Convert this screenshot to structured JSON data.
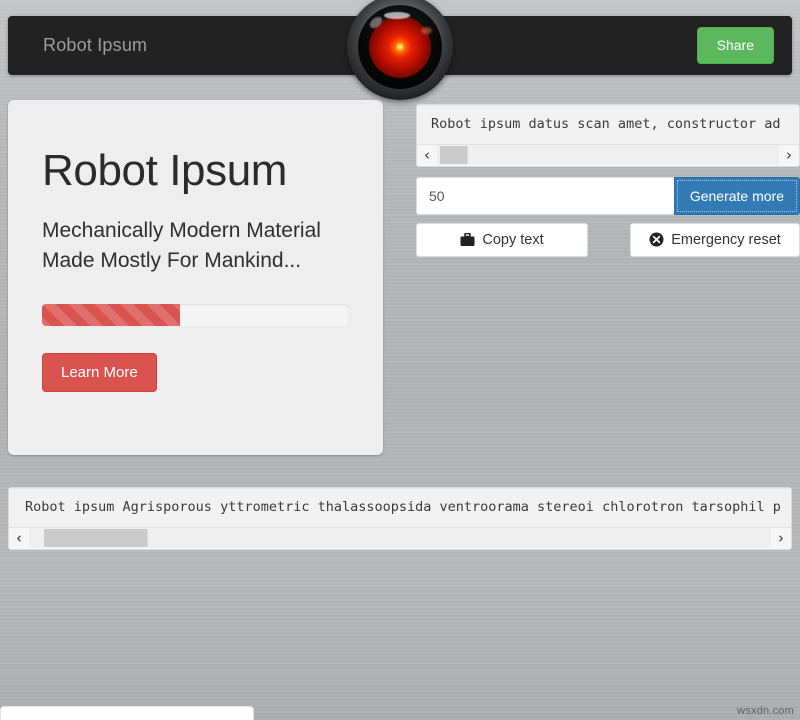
{
  "navbar": {
    "brand": "Robot Ipsum",
    "share_label": "Share",
    "share_color": "#5cb85c",
    "background_color": "#222222",
    "hal_icon": "hal-9000-eye-icon"
  },
  "jumbotron": {
    "title": "Robot Ipsum",
    "lead": "Mechanically Modern Material Made Mostly For Mankind...",
    "progress": {
      "percent": 45,
      "color": "#d9534f",
      "striped": true
    },
    "learn_more_label": "Learn More",
    "learn_more_color": "#d9534f"
  },
  "output_panel": {
    "text": "Robot ipsum datus scan amet, constructor ad",
    "scrollbar": {
      "left_arrow": "‹",
      "right_arrow": "›",
      "thumb_left_percent": 1,
      "thumb_width_percent": 8
    }
  },
  "controls": {
    "count_value": "50",
    "count_placeholder": "50",
    "generate_label": "Generate more",
    "generate_color": "#337ab7",
    "copy_label": "Copy text",
    "copy_icon": "briefcase-icon",
    "reset_label": "Emergency reset",
    "reset_icon": "circle-x-icon"
  },
  "bottom_panel": {
    "text": "Robot ipsum Agrisporous yttrometric thalassoopsida ventroorama stereoi chlorotron tarsophil p",
    "scrollbar": {
      "left_arrow": "‹",
      "right_arrow": "›",
      "thumb_left_percent": 2,
      "thumb_width_percent": 14
    }
  },
  "watermark": {
    "text": "wsxdn.com"
  }
}
